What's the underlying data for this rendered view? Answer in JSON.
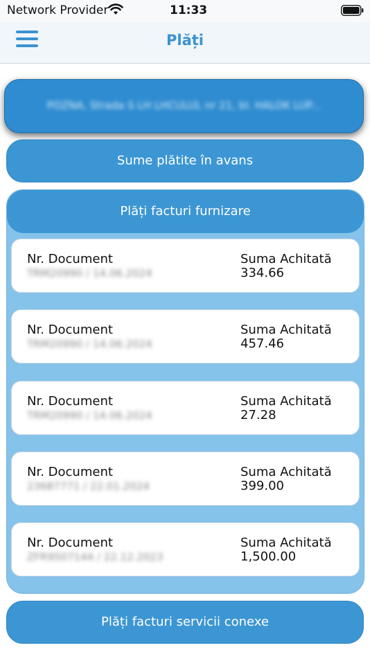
{
  "status": {
    "carrier": "Network Provider",
    "time": "11:33",
    "wifi_icon": "wifi-icon",
    "battery_icon": "battery-icon"
  },
  "nav": {
    "title": "Plăți",
    "menu_icon": "hamburger-menu-icon"
  },
  "address": {
    "text": "POZNA, Strada S LH LHCULUL nr 21, bl. HALOK LUP..."
  },
  "advance_button": {
    "label": "Sume plătite în avans"
  },
  "supplier_panel": {
    "title": "Plăți facturi furnizare",
    "doc_label": "Nr. Document",
    "sum_label": "Suma Achitată",
    "items": [
      {
        "doc": "TRM20990 / 14.06.2024",
        "sum": "334.66"
      },
      {
        "doc": "TRM20990 / 14.06.2024",
        "sum": "457.46"
      },
      {
        "doc": "TRM20990 / 14.06.2024",
        "sum": "27.28"
      },
      {
        "doc": "23687771 / 22.01.2024",
        "sum": "399.00"
      },
      {
        "doc": "ZFR9507144 / 22.12.2023",
        "sum": "1,500.00"
      }
    ]
  },
  "conexe_button": {
    "label": "Plăți facturi servicii conexe"
  },
  "colors": {
    "accent": "#3c96d4",
    "panel_bg": "#85c3ea",
    "nav_bg": "#f1f6fb"
  }
}
